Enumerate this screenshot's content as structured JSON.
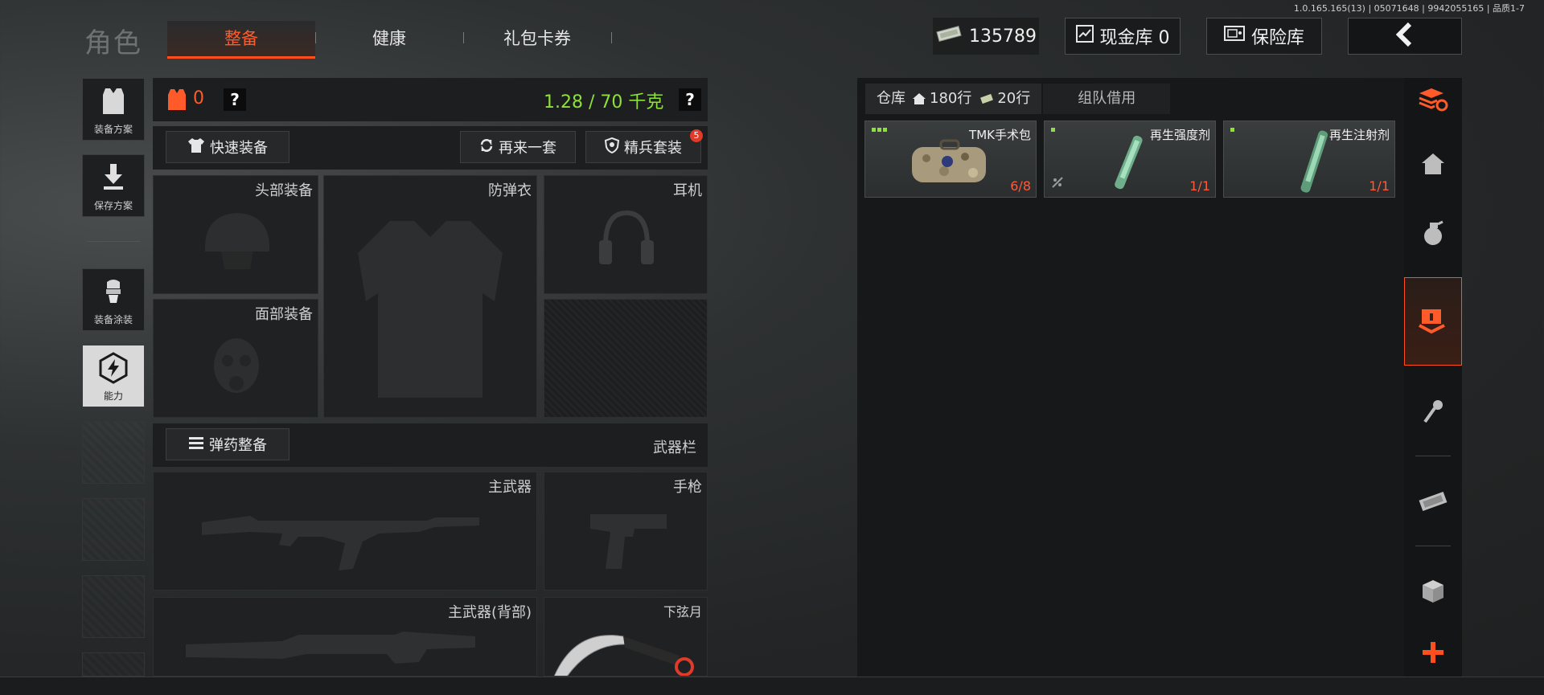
{
  "version": "1.0.165.165(13) | 05071648 | 9942055165 | 品质1-7",
  "header": {
    "title": "角色",
    "tabs": [
      {
        "label": "整备",
        "active": true
      },
      {
        "label": "健康",
        "active": false
      },
      {
        "label": "礼包卡券",
        "active": false
      }
    ],
    "money": "135789",
    "cash_vault": "现金库 0",
    "safe_box": "保险库"
  },
  "left_menu": [
    {
      "label": "装备方案",
      "icon": "vest-icon"
    },
    {
      "label": "保存方案",
      "icon": "download-icon"
    },
    {
      "label": "装备涂装",
      "icon": "spray-icon"
    },
    {
      "label": "能力",
      "icon": "ability-icon"
    }
  ],
  "loadout": {
    "armor_count": "0",
    "weight": "1.28 / 70 千克",
    "help": "?",
    "quick_equip": "快速装备",
    "again_set": "再来一套",
    "elite_set": "精兵套装",
    "elite_badge": "5",
    "slots": {
      "head": "头部装备",
      "vest": "防弹衣",
      "earphone": "耳机",
      "face": "面部装备"
    },
    "ammo_btn": "弹药整备",
    "weapon_bar": "武器栏",
    "weapons": {
      "primary": "主武器",
      "pistol": "手枪",
      "primary_back": "主武器(背部)",
      "melee": "下弦月"
    }
  },
  "warehouse": {
    "tab_label": "仓库",
    "rows": "180行",
    "rows2": "20行",
    "team_borrow": "组队借用",
    "items": [
      {
        "name": "TMK手术包",
        "count": "6/8",
        "dots": 3
      },
      {
        "name": "再生强度剂",
        "count": "1/1",
        "dots": 1
      },
      {
        "name": "再生注射剂",
        "count": "1/1",
        "dots": 1
      }
    ]
  },
  "colors": {
    "accent": "#ff4f1f",
    "weight": "#8fe03a",
    "count": "#ff5a3a"
  },
  "right_bar": [
    "refresh-stack-icon",
    "home-icon",
    "grenade-icon",
    "crate-arrow-icon",
    "key-icon",
    "cash-stack-icon",
    "box-icon",
    "plus-icon"
  ]
}
